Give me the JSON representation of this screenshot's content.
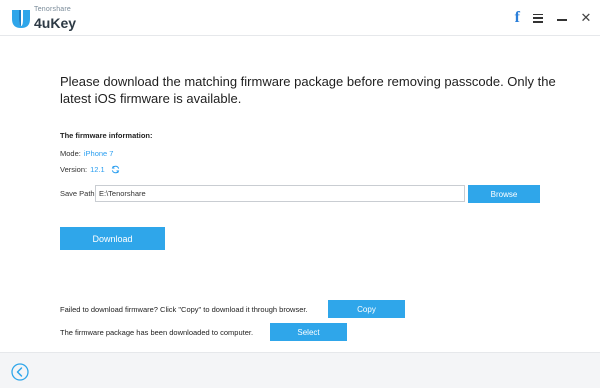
{
  "app": {
    "brand_small": "Tenorshare",
    "brand_name": "4uKey",
    "logo_icon": "4ukey-logo-icon",
    "accent_color": "#2fa6ea"
  },
  "window_controls": {
    "facebook": "f",
    "close": "✕"
  },
  "main": {
    "headline": "Please download the matching firmware package before removing passcode. Only the latest iOS firmware is available.",
    "firmware_info_title": "The firmware information:",
    "mode_label": "Mode:",
    "mode_value": "iPhone 7",
    "version_label": "Version:",
    "version_value": "12.1",
    "save_path_label": "Save Path:",
    "save_path_value": "E:\\Tenorshare",
    "browse_label": "Browse",
    "download_label": "Download",
    "failed_hint": "Failed to download firmware? Click \"Copy\" to download it through browser.",
    "copy_label": "Copy",
    "downloaded_hint": "The firmware package has been downloaded to computer.",
    "select_label": "Select"
  },
  "footer": {
    "back_icon": "back-arrow-icon"
  }
}
